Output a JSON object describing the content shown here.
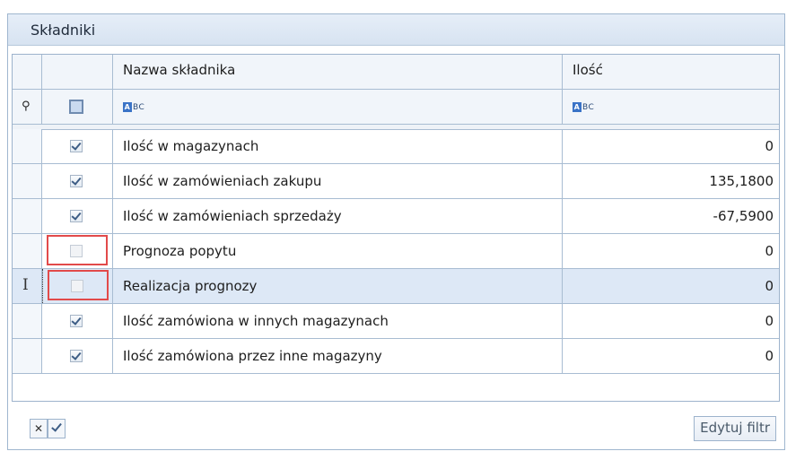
{
  "panel": {
    "title": "Składniki"
  },
  "grid": {
    "columns": [
      "Nazwa składnika",
      "Ilość"
    ],
    "filter_row": {
      "name_filter_icon": "abc-filter-icon",
      "qty_filter_icon": "abc-filter-icon",
      "pin_icon": "pin-icon"
    },
    "rows": [
      {
        "checked": true,
        "name": "Ilość w magazynach",
        "qty": "0"
      },
      {
        "checked": true,
        "name": "Ilość w zamówieniach zakupu",
        "qty": "135,1800"
      },
      {
        "checked": true,
        "name": "Ilość w zamówieniach sprzedaży",
        "qty": "-67,5900"
      },
      {
        "checked": false,
        "name": "Prognoza popytu",
        "qty": "0"
      },
      {
        "checked": false,
        "name": "Realizacja prognozy",
        "qty": "0"
      },
      {
        "checked": true,
        "name": "Ilość zamówiona w innych magazynach",
        "qty": "0"
      },
      {
        "checked": true,
        "name": "Ilość zamówiona przez inne magazyny",
        "qty": "0"
      }
    ]
  },
  "footer": {
    "edit_filter_label": "Edytuj filtr"
  },
  "colors": {
    "accent": "#3a73c7",
    "highlight": "#e24a4a",
    "selected_row": "#dde8f6"
  }
}
